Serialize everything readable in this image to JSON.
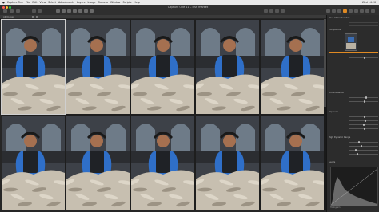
{
  "menubar": {
    "items": [
      "Capture One",
      "File",
      "Edit",
      "View",
      "Select",
      "Adjustments",
      "Layers",
      "Image",
      "Camera",
      "Window",
      "Scripts",
      "Help"
    ],
    "clock": "Wed 14:26"
  },
  "window": {
    "title": "Capture One 11 – Fish market"
  },
  "viewer": {
    "filter_label": "All Images"
  },
  "panel": {
    "sections": [
      {
        "title": "Base Characteristics"
      },
      {
        "title": "Composition"
      },
      {
        "title": "White Balance"
      },
      {
        "title": "Exposure"
      },
      {
        "title": "High Dynamic Range"
      },
      {
        "title": "Levels"
      }
    ],
    "histogram_label": "Histogram"
  },
  "colors": {
    "accent": "#e08a23",
    "background": "#262626",
    "panel": "#2c2c2c"
  },
  "thumbnails": [
    {
      "label": "fishmarket-01"
    },
    {
      "label": "fishmarket-02"
    },
    {
      "label": "fishmarket-03"
    },
    {
      "label": "fishmarket-04"
    },
    {
      "label": "fishmarket-05"
    },
    {
      "label": "fishmarket-06"
    },
    {
      "label": "fishmarket-07"
    },
    {
      "label": "fishmarket-08"
    },
    {
      "label": "fishmarket-09"
    },
    {
      "label": "fishmarket-10"
    }
  ]
}
